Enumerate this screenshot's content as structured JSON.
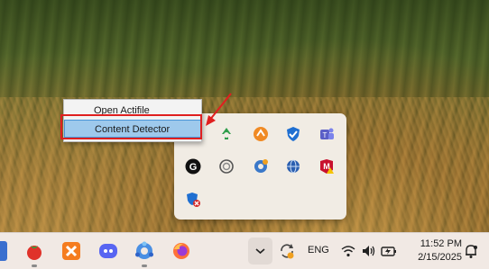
{
  "context_menu": {
    "items": [
      {
        "label": "Open Actifile"
      },
      {
        "label": "Content Detector"
      }
    ]
  },
  "tray_flyout": {
    "icons": [
      {
        "name": "green-recycle-icon"
      },
      {
        "name": "orange-sync-icon"
      },
      {
        "name": "shield-check-icon"
      },
      {
        "name": "teams-icon"
      },
      {
        "name": "g-logo-icon"
      },
      {
        "name": "circle-app-icon"
      },
      {
        "name": "update-globe-icon"
      },
      {
        "name": "globe-app-icon"
      },
      {
        "name": "mcafee-warning-icon"
      },
      {
        "name": "defender-error-icon"
      }
    ]
  },
  "taskbar": {
    "apps": [
      "tomato-app-icon",
      "xampp-icon",
      "discord-icon",
      "copilot-icon",
      "firefox-icon"
    ],
    "language": "ENG",
    "time": "11:52 PM",
    "date": "2/15/2025"
  },
  "colors": {
    "highlight_border": "#e01f1f",
    "menu_selected": "#9ec9ec",
    "taskbar_bg": "#f1e9e4"
  }
}
